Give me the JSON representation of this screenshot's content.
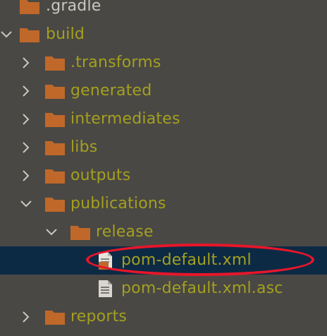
{
  "tree": {
    "items": [
      {
        "label": ".gradle",
        "kind": "folder",
        "expanded": false,
        "has_arrow": false
      },
      {
        "label": "build",
        "kind": "folder",
        "expanded": true,
        "has_arrow": true
      },
      {
        "label": ".transforms",
        "kind": "folder",
        "expanded": false,
        "has_arrow": true
      },
      {
        "label": "generated",
        "kind": "folder",
        "expanded": false,
        "has_arrow": true
      },
      {
        "label": "intermediates",
        "kind": "folder",
        "expanded": false,
        "has_arrow": true
      },
      {
        "label": "libs",
        "kind": "folder",
        "expanded": false,
        "has_arrow": true
      },
      {
        "label": "outputs",
        "kind": "folder",
        "expanded": false,
        "has_arrow": true
      },
      {
        "label": "publications",
        "kind": "folder",
        "expanded": true,
        "has_arrow": true
      },
      {
        "label": "release",
        "kind": "folder",
        "expanded": true,
        "has_arrow": true
      },
      {
        "label": "pom-default.xml",
        "kind": "xml-file",
        "selected": true
      },
      {
        "label": "pom-default.xml.asc",
        "kind": "text-file",
        "selected": false
      },
      {
        "label": "reports",
        "kind": "folder",
        "expanded": false,
        "has_arrow": true
      }
    ]
  },
  "colors": {
    "background": "#4a4844",
    "selection": "#0d2a45",
    "folder": "#c0682a",
    "label_olive": "#a3a020",
    "annotation_red": "#e8162a"
  }
}
